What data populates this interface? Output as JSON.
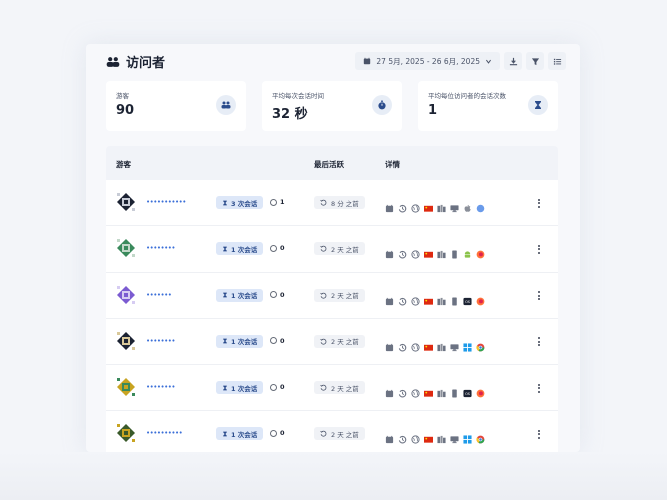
{
  "header": {
    "title": "访问者",
    "date_range": "27 5月, 2025 - 26 6月, 2025"
  },
  "stats": [
    {
      "label": "游客",
      "value": "90",
      "icon": "users-icon"
    },
    {
      "label": "平均每次会话时间",
      "value": "32 秒",
      "icon": "stopwatch-icon"
    },
    {
      "label": "平均每位访问者的会话次数",
      "value": "1",
      "icon": "hourglass-icon"
    }
  ],
  "table": {
    "headers": [
      "游客",
      "最后活跃",
      "详情"
    ],
    "rows": [
      {
        "name": "•••••••••••",
        "sessions": "3 次会话",
        "views": "1",
        "ago": "8 分 之前",
        "os": "apple",
        "browser": "chrome-blue",
        "device": "desktop"
      },
      {
        "name": "••••••••",
        "sessions": "1 次会话",
        "views": "0",
        "ago": "2 天 之前",
        "os": "android",
        "browser": "firefox",
        "device": "mobile"
      },
      {
        "name": "•••••••",
        "sessions": "1 次会话",
        "views": "0",
        "ago": "2 天 之前",
        "os": "other",
        "browser": "firefox",
        "device": "mobile"
      },
      {
        "name": "••••••••",
        "sessions": "1 次会话",
        "views": "0",
        "ago": "2 天 之前",
        "os": "windows",
        "browser": "chrome",
        "device": "desktop"
      },
      {
        "name": "••••••••",
        "sessions": "1 次会话",
        "views": "0",
        "ago": "2 天 之前",
        "os": "other",
        "browser": "firefox",
        "device": "mobile"
      },
      {
        "name": "••••••••••",
        "sessions": "1 次会话",
        "views": "0",
        "ago": "2 天 之前",
        "os": "windows",
        "browser": "chrome",
        "device": "desktop"
      }
    ]
  },
  "colors": {
    "accent": "#3b6fd8",
    "badge_bg": "#dde7f8",
    "badge_text": "#2b4c8c",
    "flag_red": "#de2910"
  }
}
